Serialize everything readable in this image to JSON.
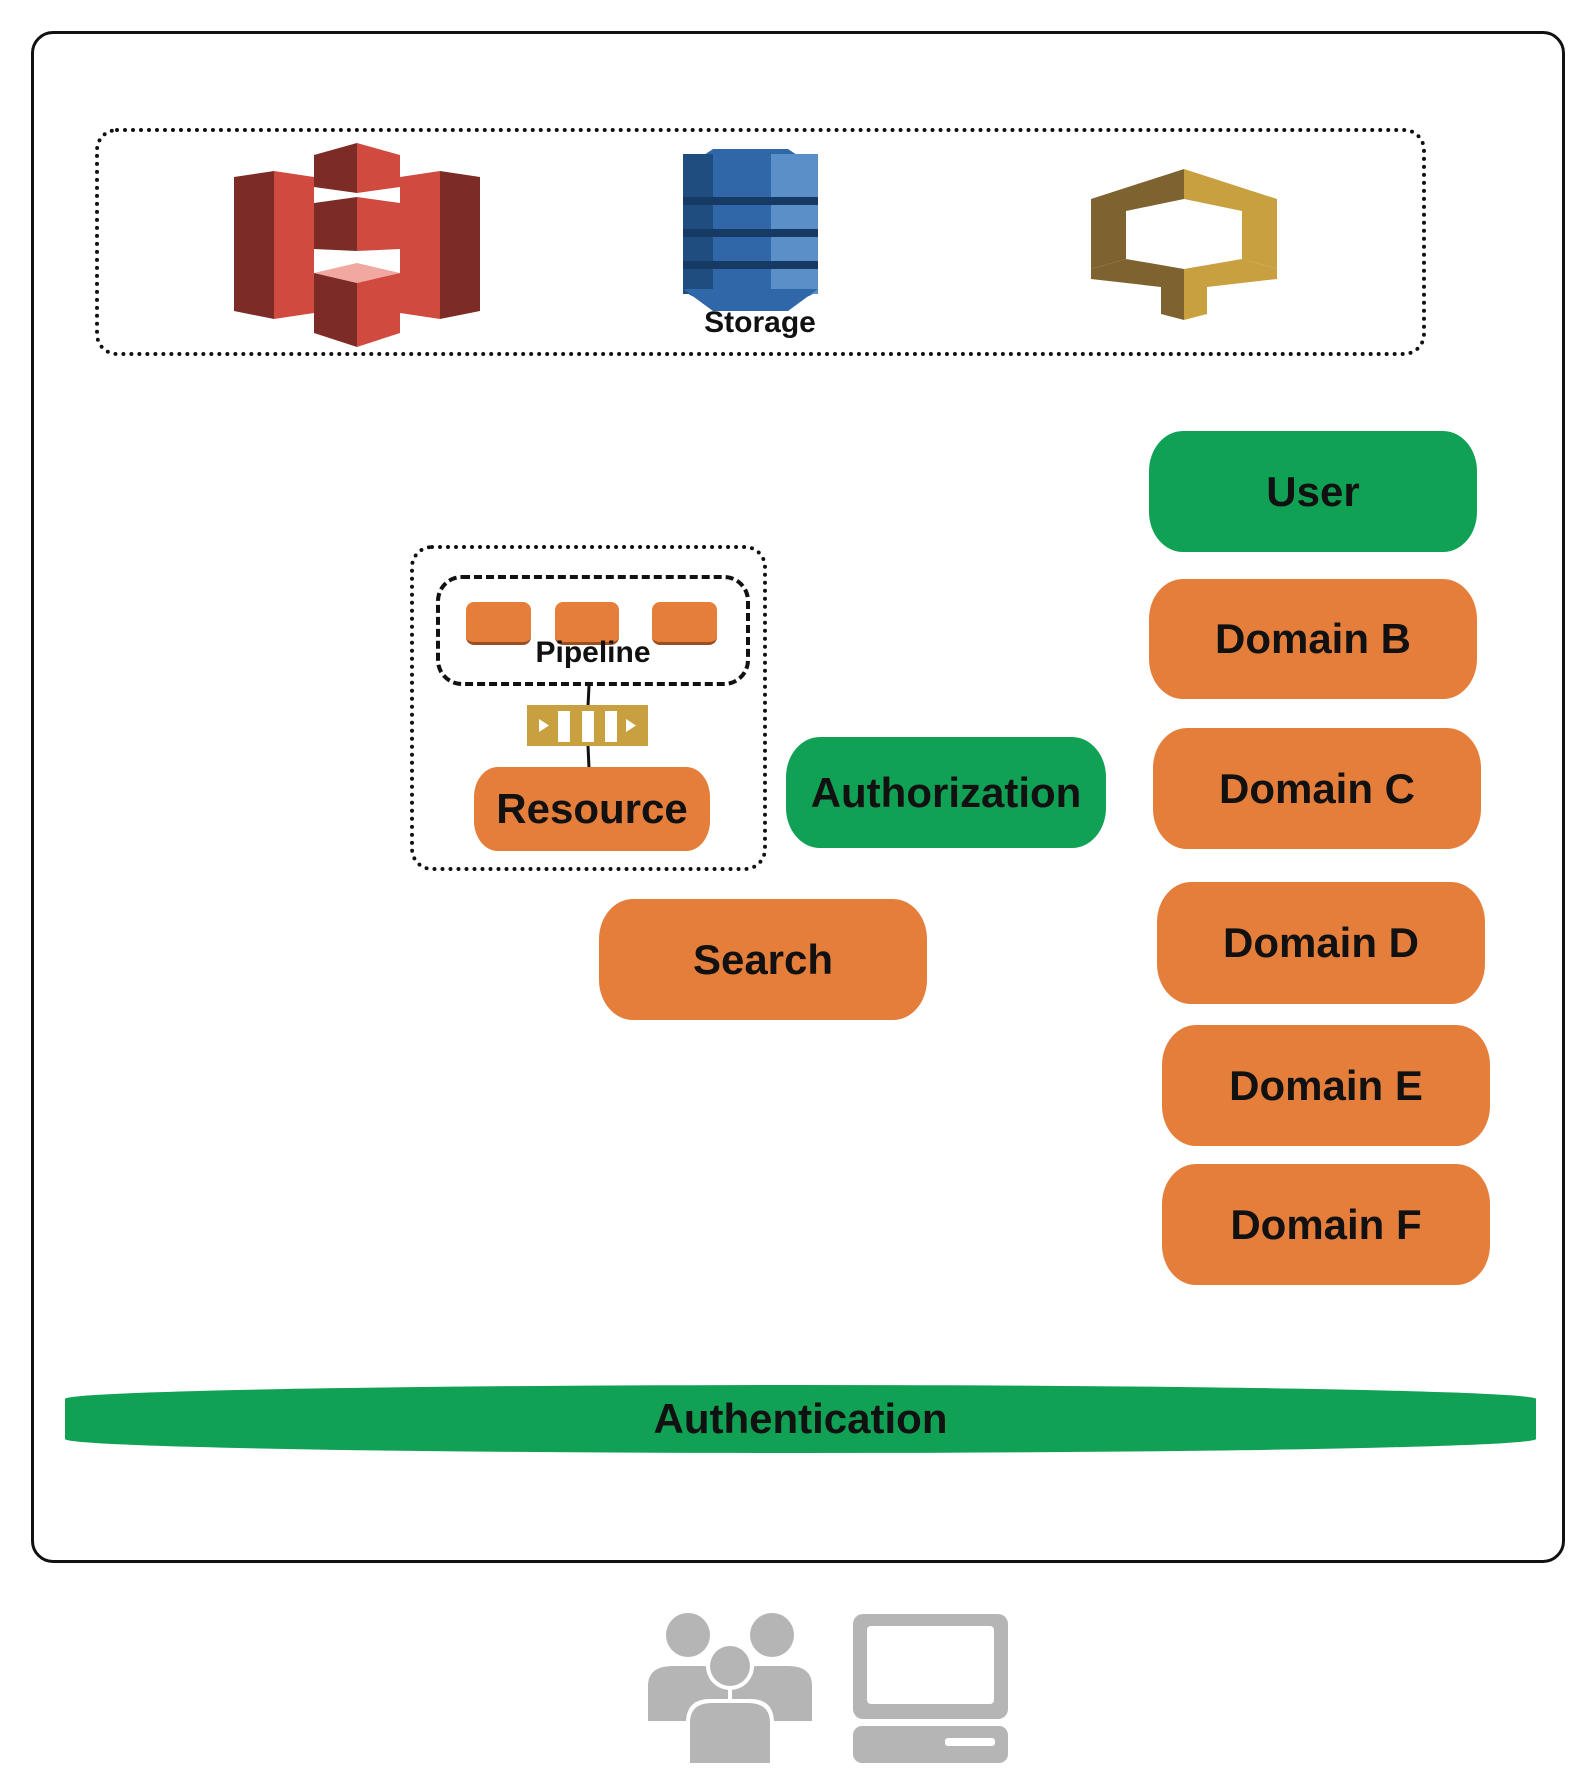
{
  "storage_group": {
    "label": "Storage",
    "icons": [
      "s3-bucket-icon",
      "dynamodb-database-icon",
      "api-gateway-icon"
    ]
  },
  "nodes": {
    "user": "User",
    "domain_b": "Domain B",
    "domain_c": "Domain C",
    "domain_d": "Domain D",
    "domain_e": "Domain E",
    "domain_f": "Domain F",
    "authorization": "Authorization",
    "search": "Search",
    "resource": "Resource",
    "pipeline": "Pipeline",
    "authentication": "Authentication"
  },
  "clients": {
    "icons": [
      "users-group-icon",
      "laptop-icon"
    ]
  },
  "colors": {
    "orange": "#e67e3b",
    "green": "#11a155",
    "s3_red": "#d04a3f",
    "dynamo_blue": "#2f67a8",
    "gold": "#c9a040",
    "client_gray": "#b5b5b5"
  }
}
